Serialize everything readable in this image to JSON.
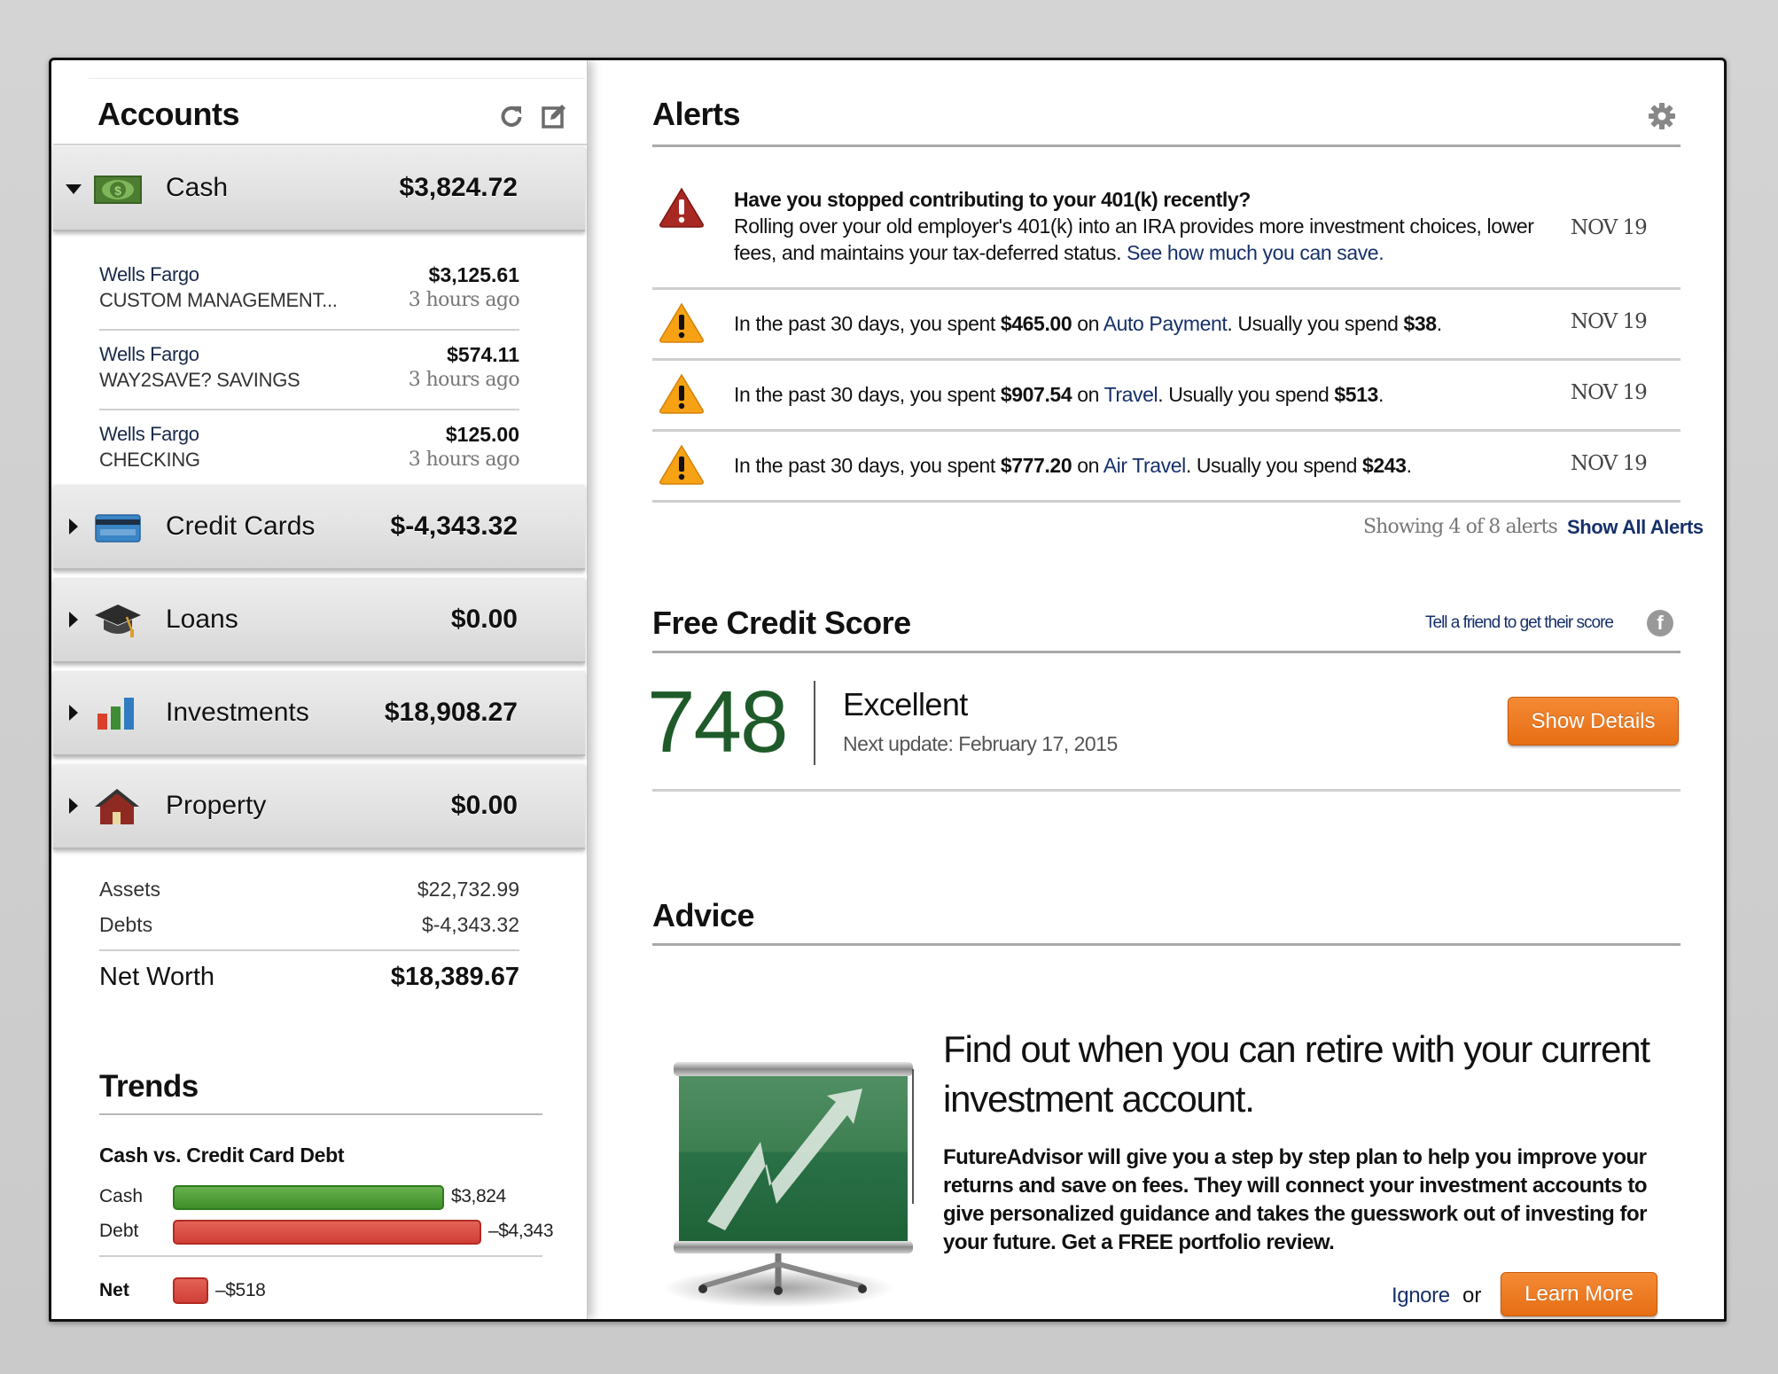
{
  "accounts": {
    "title": "Accounts",
    "header_icons": [
      "refresh-icon",
      "edit-icon"
    ],
    "categories": [
      {
        "label": "Cash",
        "amount": "$3,824.72",
        "icon": "cash-icon",
        "expanded": true
      },
      {
        "label": "Credit Cards",
        "amount": "$-4,343.32",
        "icon": "credit-card-icon",
        "expanded": false
      },
      {
        "label": "Loans",
        "amount": "$0.00",
        "icon": "graduation-cap-icon",
        "expanded": false
      },
      {
        "label": "Investments",
        "amount": "$18,908.27",
        "icon": "bar-chart-icon",
        "expanded": false
      },
      {
        "label": "Property",
        "amount": "$0.00",
        "icon": "house-icon",
        "expanded": false
      }
    ],
    "cash_accounts": [
      {
        "bank": "Wells Fargo",
        "name": "CUSTOM MANAGEMENT...",
        "amount": "$3,125.61",
        "updated": "3 hours ago"
      },
      {
        "bank": "Wells Fargo",
        "name": "WAY2SAVE? SAVINGS",
        "amount": "$574.11",
        "updated": "3 hours ago"
      },
      {
        "bank": "Wells Fargo",
        "name": "CHECKING",
        "amount": "$125.00",
        "updated": "3 hours ago"
      }
    ],
    "summary": {
      "assets_label": "Assets",
      "assets": "$22,732.99",
      "debts_label": "Debts",
      "debts": "$-4,343.32",
      "net_worth_label": "Net Worth",
      "net_worth": "$18,389.67"
    }
  },
  "trends": {
    "title": "Trends",
    "chart_title": "Cash vs. Credit Card Debt",
    "bars": [
      {
        "label": "Cash",
        "value": 3824,
        "display": "$3,824",
        "color": "#4a9a35"
      },
      {
        "label": "Debt",
        "value": 4343,
        "display": "–$4,343",
        "color": "#d9463d"
      }
    ],
    "net": {
      "label": "Net",
      "value": -518,
      "display": "–$518",
      "color": "#d9463d"
    }
  },
  "alerts": {
    "title": "Alerts",
    "settings_icon": "gear-icon",
    "items": [
      {
        "severity": "danger",
        "headline": "Have you stopped contributing to your 401(k) recently?",
        "body": "Rolling over your old employer's 401(k) into an IRA provides more investment choices, lower fees, and maintains your tax-deferred status.",
        "link": "See how much you can save.",
        "date": "NOV 19"
      },
      {
        "severity": "warning",
        "prefix": "In the past 30 days, you spent ",
        "spent": "$465.00",
        "on": " on ",
        "category": "Auto Payment",
        "mid": ". Usually you spend ",
        "usual": "$38",
        "end": ".",
        "date": "NOV 19"
      },
      {
        "severity": "warning",
        "prefix": "In the past 30 days, you spent ",
        "spent": "$907.54",
        "on": " on ",
        "category": "Travel",
        "mid": ". Usually you spend ",
        "usual": "$513",
        "end": ".",
        "date": "NOV 19"
      },
      {
        "severity": "warning",
        "prefix": "In the past 30 days, you spent ",
        "spent": "$777.20",
        "on": " on ",
        "category": "Air Travel",
        "mid": ". Usually you spend ",
        "usual": "$243",
        "end": ".",
        "date": "NOV 19"
      }
    ],
    "showing_text": "Showing 4 of 8 alerts",
    "show_all_label": "Show All Alerts"
  },
  "credit_score": {
    "title": "Free Credit Score",
    "tell_friend": "Tell a friend to get their score",
    "score": "748",
    "rating": "Excellent",
    "next_update": "Next update: February 17, 2015",
    "button_label": "Show Details",
    "score_color": "#1f5b2a"
  },
  "advice": {
    "title": "Advice",
    "heading": "Find out when you can retire with your current investment account.",
    "body": "FutureAdvisor will give you a step by step plan to help you improve your returns and save on fees. They will connect your investment accounts to give personalized guidance and takes the guesswork out of investing for your future. Get a FREE portfolio review.",
    "ignore_label": "Ignore",
    "or_label": "or",
    "learn_more_label": "Learn More"
  },
  "colors": {
    "accent_orange": "#ec7a20",
    "link_blue": "#16306a",
    "cash_green": "#4a9a35",
    "debt_red": "#d9463d"
  }
}
